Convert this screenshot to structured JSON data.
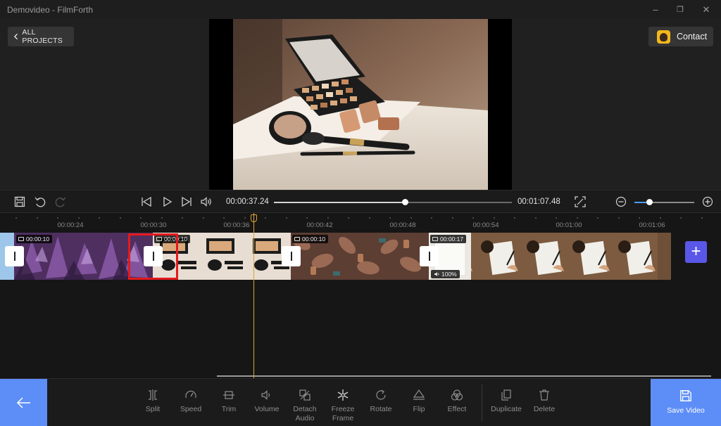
{
  "window": {
    "title": "Demovideo - FilmForth",
    "minimize_glyph": "–",
    "restore_glyph": "❐",
    "close_glyph": "✕"
  },
  "header": {
    "all_projects_label": "ALL PROJECTS",
    "contact_label": "Contact"
  },
  "preview": {
    "icon": "makeup-palette-photo"
  },
  "playback": {
    "current_time": "00:00:37.24",
    "total_time": "00:01:07.48",
    "progress": 0.55,
    "zoom_level": 0.25,
    "icons": [
      "save-icon",
      "undo-icon",
      "redo-icon",
      "skip-back-icon",
      "play-icon",
      "skip-forward-icon",
      "volume-icon",
      "fullscreen-icon",
      "zoom-out-icon",
      "zoom-in-icon"
    ]
  },
  "timeline": {
    "ruler_labels": [
      "00:00:24",
      "00:00:30",
      "00:00:36",
      "00:00:42",
      "00:00:48",
      "00:00:54",
      "00:01:00",
      "00:01:06"
    ],
    "clips": [
      {
        "name": "purple-crystals",
        "duration": "00:00:10",
        "type": "image"
      },
      {
        "name": "makeup-palette",
        "duration": "00:00:10",
        "type": "image"
      },
      {
        "name": "autumn-leaves",
        "duration": "00:00:10",
        "type": "image"
      },
      {
        "name": "writing-hands",
        "duration": "00:00:17",
        "type": "video",
        "volume": "100%"
      }
    ],
    "add_label": "+"
  },
  "toolbar": {
    "back_icon": "arrow-left-icon",
    "tools": [
      {
        "label": "Split",
        "icon": "split-icon"
      },
      {
        "label": "Speed",
        "icon": "speed-icon"
      },
      {
        "label": "Trim",
        "icon": "trim-icon"
      },
      {
        "label": "Volume",
        "icon": "volume-icon"
      },
      {
        "label": "Detach Audio",
        "line1": "Detach",
        "line2": "Audio",
        "icon": "detach-audio-icon"
      },
      {
        "label": "Freeze Frame",
        "line1": "Freeze",
        "line2": "Frame",
        "icon": "snowflake-icon"
      },
      {
        "label": "Rotate",
        "icon": "rotate-icon"
      },
      {
        "label": "Flip",
        "icon": "flip-icon"
      },
      {
        "label": "Effect",
        "icon": "effect-icon"
      },
      {
        "label": "Duplicate",
        "icon": "duplicate-icon"
      },
      {
        "label": "Delete",
        "icon": "trash-icon"
      }
    ],
    "save_label": "Save Video"
  },
  "colors": {
    "accent": "#5d8ef7",
    "playhead": "#e0a431",
    "highlight": "#e5191d",
    "add_button": "#5a57e8"
  }
}
